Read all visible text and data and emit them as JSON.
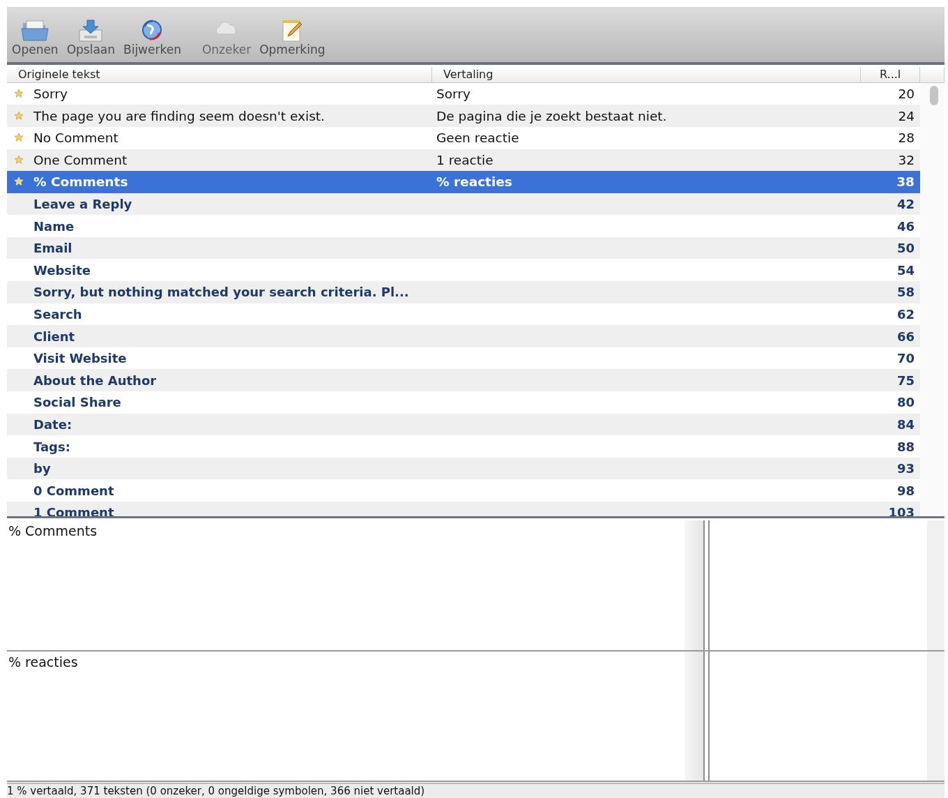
{
  "toolbar": [
    {
      "kind": "open",
      "label": "Openen",
      "disabled": false
    },
    {
      "kind": "save",
      "label": "Opslaan",
      "disabled": false
    },
    {
      "kind": "update",
      "label": "Bijwerken",
      "disabled": false
    },
    {
      "kind": "fuzzy",
      "label": "Onzeker",
      "disabled": true
    },
    {
      "kind": "comment",
      "label": "Opmerking",
      "disabled": false
    }
  ],
  "table": {
    "columns": [
      "Originele tekst",
      "Vertaling",
      "R...l"
    ],
    "rows": [
      {
        "original": "Sorry",
        "translation": "Sorry",
        "reference": "20",
        "translated": true,
        "selected": false
      },
      {
        "original": "The page you are finding seem doesn't exist.",
        "translation": "De pagina die je zoekt bestaat niet.",
        "reference": "24",
        "translated": true,
        "selected": false
      },
      {
        "original": "No Comment",
        "translation": "Geen reactie",
        "reference": "28",
        "translated": true,
        "selected": false
      },
      {
        "original": "One Comment",
        "translation": "1 reactie",
        "reference": "32",
        "translated": true,
        "selected": false
      },
      {
        "original": "% Comments",
        "translation": "% reacties",
        "reference": "38",
        "translated": true,
        "selected": true
      },
      {
        "original": "Leave a Reply",
        "reference": "42",
        "translated": false,
        "selected": false
      },
      {
        "original": "Name",
        "reference": "46",
        "translated": false,
        "selected": false
      },
      {
        "original": "Email",
        "reference": "50",
        "translated": false,
        "selected": false
      },
      {
        "original": "Website",
        "reference": "54",
        "translated": false,
        "selected": false
      },
      {
        "original": "Sorry, but nothing matched your search criteria. Pl...",
        "reference": "58",
        "translated": false,
        "selected": false
      },
      {
        "original": "Search",
        "reference": "62",
        "translated": false,
        "selected": false
      },
      {
        "original": "Client",
        "reference": "66",
        "translated": false,
        "selected": false
      },
      {
        "original": "Visit Website",
        "reference": "70",
        "translated": false,
        "selected": false
      },
      {
        "original": "About the Author",
        "reference": "75",
        "translated": false,
        "selected": false
      },
      {
        "original": "Social Share",
        "reference": "80",
        "translated": false,
        "selected": false
      },
      {
        "original": "Date:",
        "reference": "84",
        "translated": false,
        "selected": false
      },
      {
        "original": "Tags:",
        "reference": "88",
        "translated": false,
        "selected": false
      },
      {
        "original": "by",
        "reference": "93",
        "translated": false,
        "selected": false
      },
      {
        "original": "0 Comment",
        "reference": "98",
        "translated": false,
        "selected": false
      },
      {
        "original": "1 Comment",
        "reference": "103",
        "translated": false,
        "selected": false
      }
    ]
  },
  "source_text": "% Comments",
  "translation_text": "% reacties",
  "status_bar": "1 % vertaald, 371 teksten (0 onzeker, 0 ongeldige symbolen, 366 niet vertaald)"
}
